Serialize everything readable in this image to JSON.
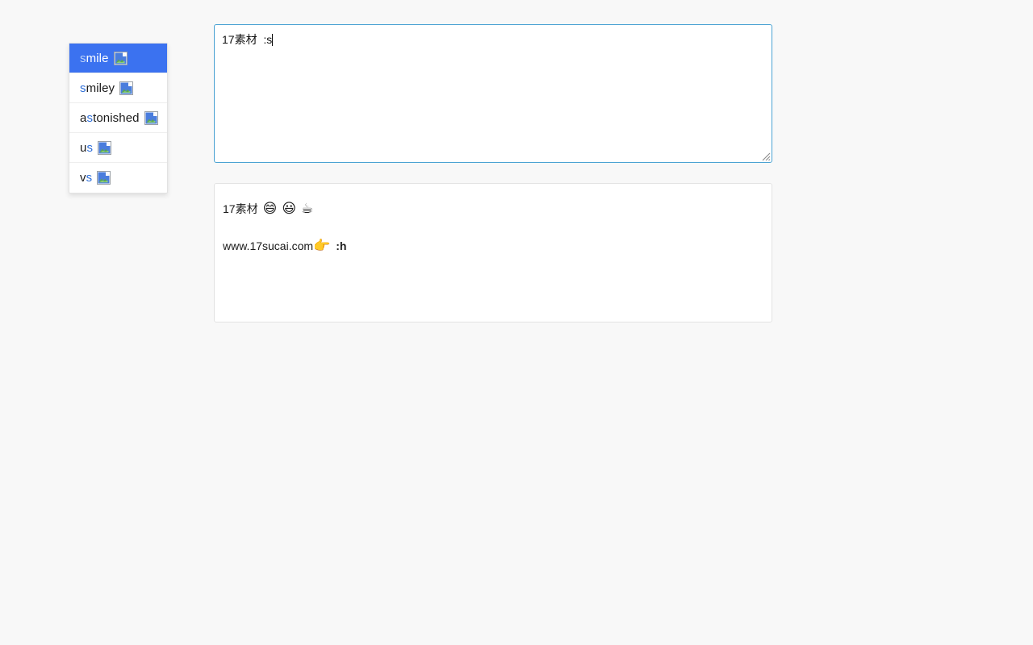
{
  "page": {
    "background_color": "#f8f8f8"
  },
  "autocomplete": {
    "name": "emoji-autocomplete",
    "active_index": 0,
    "accent_color": "#3b72f0",
    "match_color": "#2f6fd8",
    "query": "s",
    "items": [
      {
        "prefix": "",
        "match": "s",
        "suffix": "mile",
        "icon": "broken-image-icon",
        "selected": true
      },
      {
        "prefix": "",
        "match": "s",
        "suffix": "miley",
        "icon": "broken-image-icon",
        "selected": false
      },
      {
        "prefix": "a",
        "match": "s",
        "suffix": "tonished",
        "icon": "broken-image-icon",
        "selected": false
      },
      {
        "prefix": "u",
        "match": "s",
        "suffix": "",
        "icon": "broken-image-icon",
        "selected": false
      },
      {
        "prefix": "v",
        "match": "s",
        "suffix": "",
        "icon": "broken-image-icon",
        "selected": false
      }
    ]
  },
  "editor": {
    "name": "message-textarea",
    "value": "17素材  :s",
    "placeholder": "",
    "border_color": "#4ba3d3",
    "caret_visible": true,
    "resize_handle": "resize-grip-icon"
  },
  "preview": {
    "name": "emoji-preview-panel",
    "lines": [
      {
        "text": "17素材",
        "emojis": [
          "😄",
          "😃",
          "☕"
        ],
        "trailing_code": ""
      },
      {
        "text": "www.17sucai.com",
        "emojis": [
          "👉"
        ],
        "trailing_code": ":h"
      }
    ]
  }
}
